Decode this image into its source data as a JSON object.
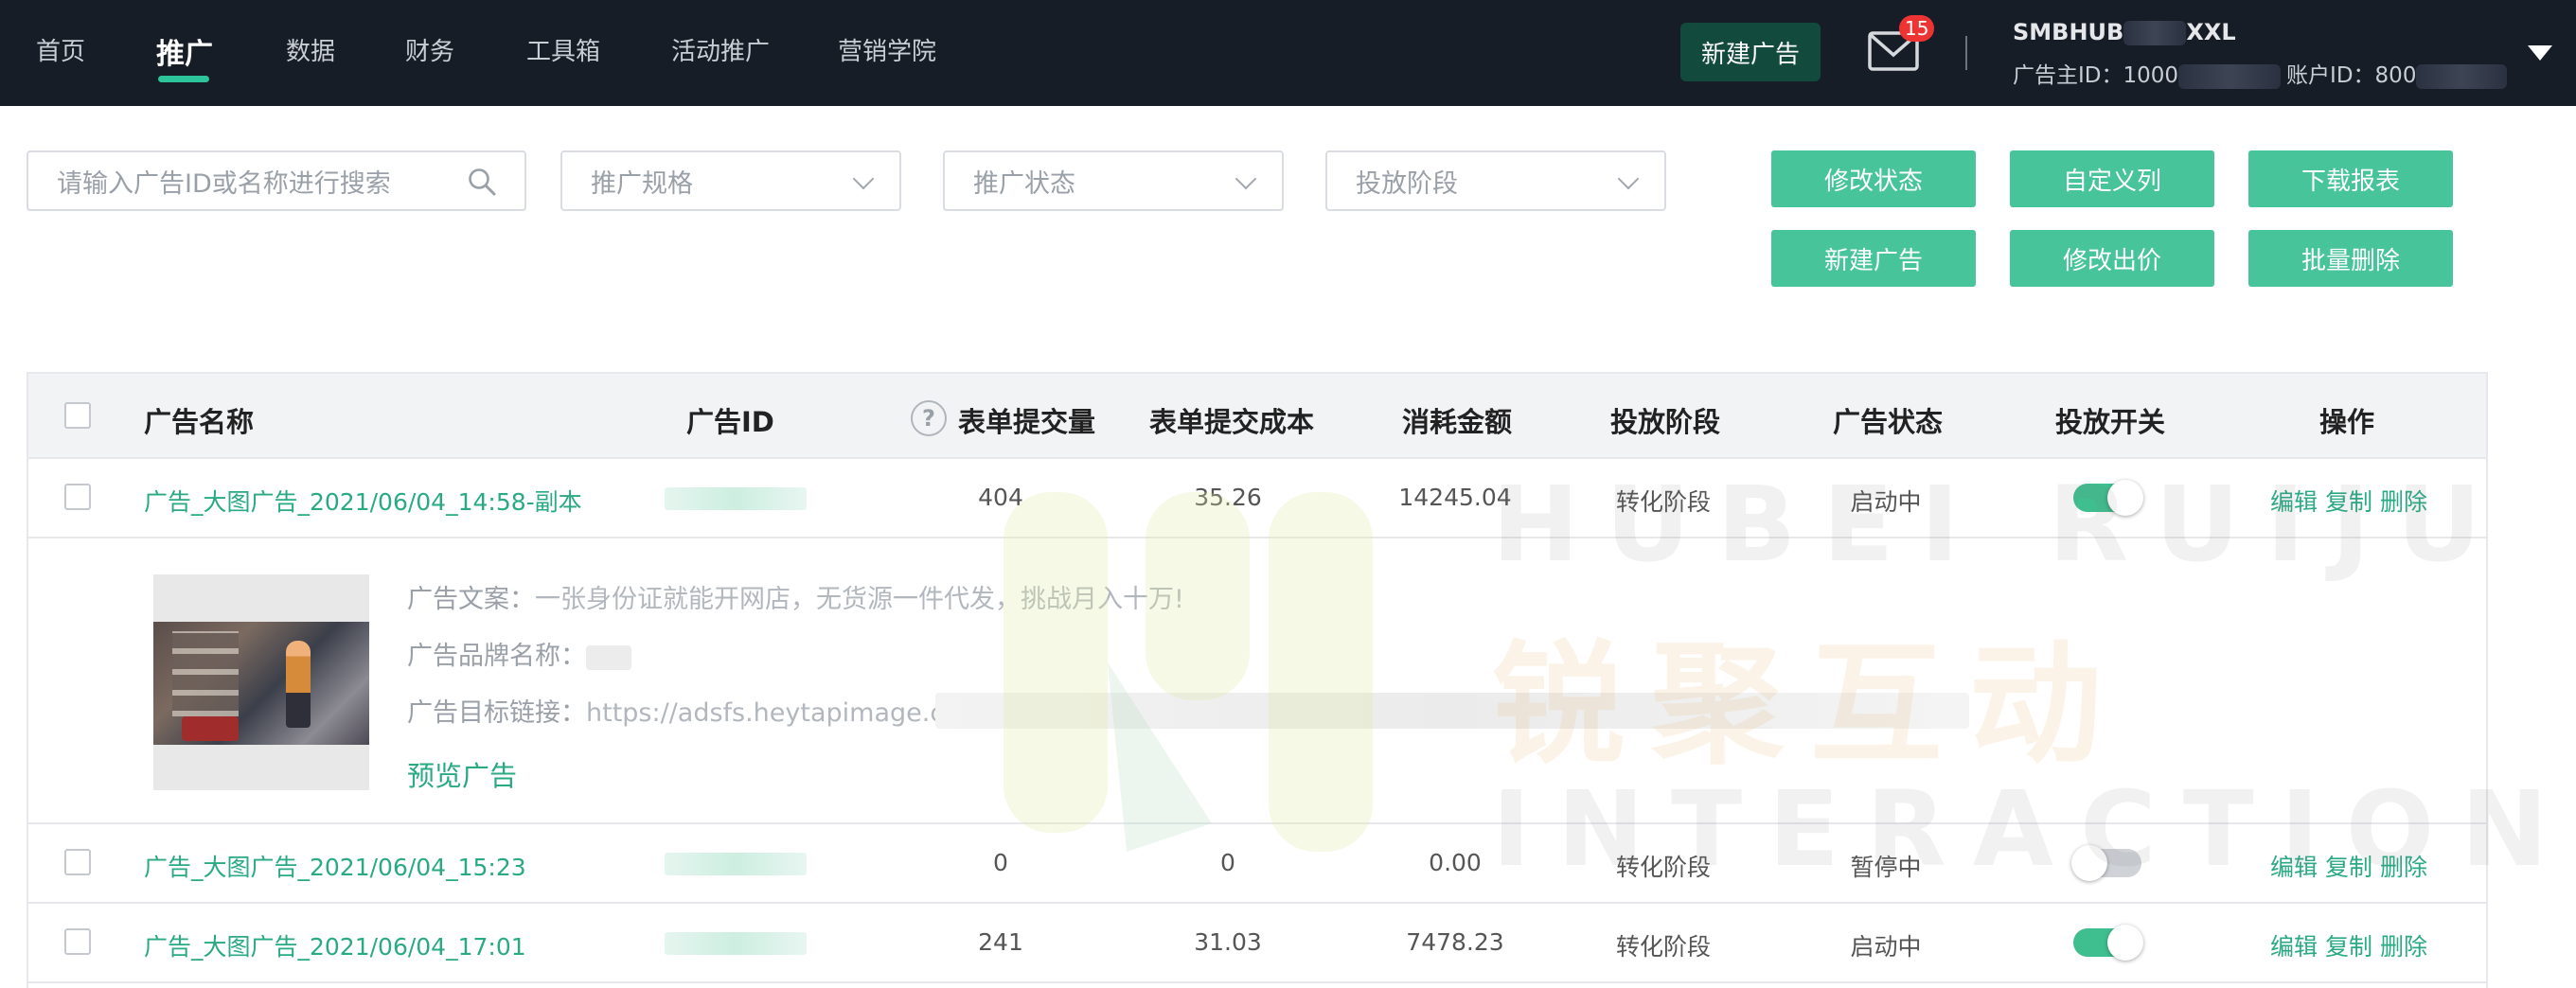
{
  "nav": {
    "items": [
      "首页",
      "推广",
      "数据",
      "财务",
      "工具箱",
      "活动推广",
      "营销学院"
    ],
    "active_index": 1
  },
  "header": {
    "new_ad_button": "新建广告",
    "mail_badge": "15",
    "account_name_prefix": "SMBHUB",
    "account_name_suffix": "XXL",
    "advertiser_id_label": "广告主ID：",
    "advertiser_id_visible": "1000",
    "account_id_label": "账户ID：",
    "account_id_visible": "800"
  },
  "filters": {
    "search_placeholder": "请输入广告ID或名称进行搜索",
    "spec_placeholder": "推广规格",
    "status_placeholder": "推广状态",
    "stage_placeholder": "投放阶段"
  },
  "actions": {
    "modify_status": "修改状态",
    "custom_columns": "自定义列",
    "download_report": "下载报表",
    "new_ad": "新建广告",
    "modify_bid": "修改出价",
    "batch_delete": "批量删除"
  },
  "table": {
    "columns": {
      "name": "广告名称",
      "id": "广告ID",
      "form_submissions": "表单提交量",
      "form_cost": "表单提交成本",
      "spend": "消耗金额",
      "stage": "投放阶段",
      "status": "广告状态",
      "switch": "投放开关",
      "ops": "操作"
    },
    "help_icon_glyph": "?",
    "row_actions": {
      "edit": "编辑",
      "copy": "复制",
      "delete": "删除"
    },
    "rows": [
      {
        "name": "广告_大图广告_2021/06/04_14:58-副本",
        "form_submissions": "404",
        "form_cost": "35.26",
        "spend": "14245.04",
        "stage": "转化阶段",
        "status": "启动中",
        "switch_on": true
      },
      {
        "name": "广告_大图广告_2021/06/04_15:23",
        "form_submissions": "0",
        "form_cost": "0",
        "spend": "0.00",
        "stage": "转化阶段",
        "status": "暂停中",
        "switch_on": false
      },
      {
        "name": "广告_大图广告_2021/06/04_17:01",
        "form_submissions": "241",
        "form_cost": "31.03",
        "spend": "7478.23",
        "stage": "转化阶段",
        "status": "启动中",
        "switch_on": true
      }
    ],
    "detail": {
      "copy_label": "广告文案：",
      "copy_text": "一张身份证就能开网店，无货源一件代发，挑战月入十万!",
      "brand_label": "广告品牌名称：",
      "link_label": "广告目标链接：",
      "link_text": "https://adsfs.heytapimage.co",
      "preview_label": "预览广告"
    }
  },
  "watermark": {
    "line1": "HUBEI RUIJU",
    "line2": "锐聚互动",
    "line3": "INTERACTION"
  },
  "colors": {
    "topbar": "#171d27",
    "accent": "#48c49a",
    "link": "#2aaa82",
    "badge": "#e33333"
  }
}
